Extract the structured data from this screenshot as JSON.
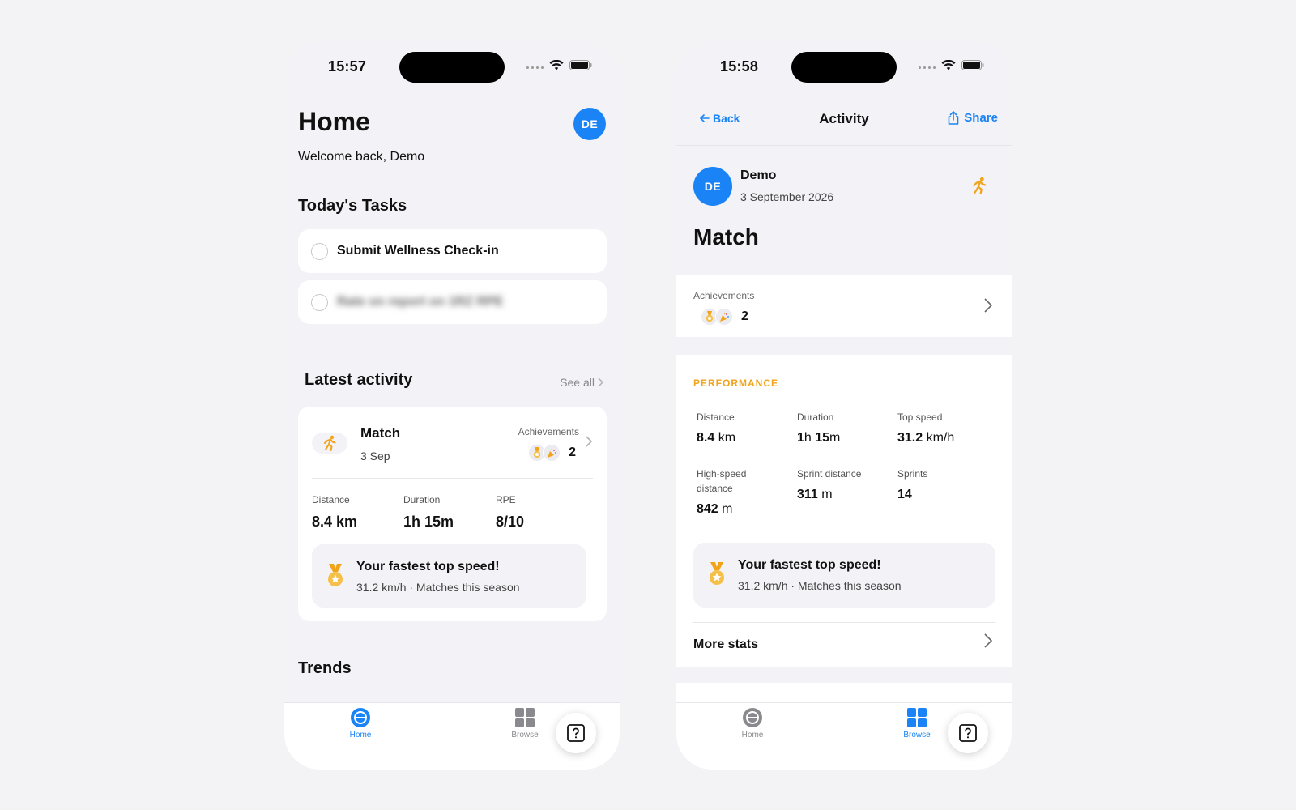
{
  "home_screen": {
    "status_time": "15:57",
    "title": "Home",
    "avatar_initials": "DE",
    "welcome": "Welcome back, Demo",
    "tasks_title": "Today's Tasks",
    "tasks": [
      {
        "label": "Submit Wellness Check-in"
      },
      {
        "label": "Rate on report on 1RZ RPE"
      }
    ],
    "latest_title": "Latest activity",
    "see_all": "See all",
    "activity": {
      "name": "Match",
      "date": "3 Sep",
      "achievements_label": "Achievements",
      "achievements_count": "2",
      "stats": [
        {
          "label": "Distance",
          "value": "8.4 km"
        },
        {
          "label": "Duration",
          "value": "1h 15m"
        },
        {
          "label": "RPE",
          "value": "8/10"
        }
      ],
      "highlight_title": "Your fastest top speed!",
      "highlight_sub": "31.2 km/h · Matches this season"
    },
    "trends_title": "Trends",
    "tabs": [
      {
        "label": "Home",
        "active": true
      },
      {
        "label": "Browse",
        "active": false
      }
    ]
  },
  "activity_screen": {
    "status_time": "15:58",
    "nav": {
      "back": "Back",
      "title": "Activity",
      "share": "Share"
    },
    "user_initials": "DE",
    "user_name": "Demo",
    "date": "3 September 2026",
    "title": "Match",
    "achievements_label": "Achievements",
    "achievements_count": "2",
    "performance_label": "PERFORMANCE",
    "stats": [
      {
        "label": "Distance",
        "num": "8.4",
        "unit": "km"
      },
      {
        "label": "Duration",
        "num": "1",
        "unit": "h ",
        "num2": "15",
        "unit2": "m"
      },
      {
        "label": "Top speed",
        "num": "31.2",
        "unit": "km/h"
      },
      {
        "label": "High-speed distance",
        "num": "842",
        "unit": "m"
      },
      {
        "label": "Sprint distance",
        "num": "311",
        "unit": "m"
      },
      {
        "label": "Sprints",
        "num": "14",
        "unit": ""
      }
    ],
    "highlight_title": "Your fastest top speed!",
    "highlight_sub": "31.2 km/h · Matches this season",
    "more_stats": "More stats",
    "tabs": [
      {
        "label": "Home",
        "active": false
      },
      {
        "label": "Browse",
        "active": true
      }
    ]
  },
  "colors": {
    "accent": "#1a84f6",
    "medal": "#f1a31a",
    "background": "#f2f2f7"
  },
  "icons": [
    "wifi-icon",
    "battery-icon",
    "runner-icon",
    "medal-icon",
    "party-icon",
    "chevron-right-icon",
    "back-arrow-icon",
    "share-icon",
    "home-tab-icon",
    "browse-tab-icon",
    "help-icon"
  ]
}
